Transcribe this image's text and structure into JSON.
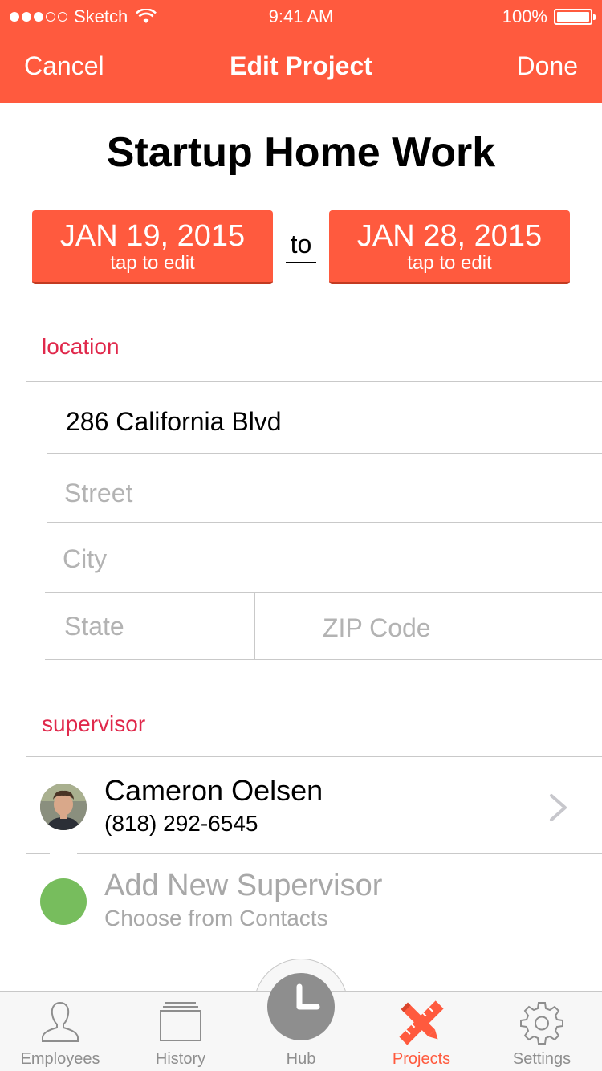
{
  "status_bar": {
    "carrier": "Sketch",
    "time": "9:41 AM",
    "battery": "100%",
    "signal_bars_filled": 3,
    "signal_bars_total": 5
  },
  "nav": {
    "cancel_label": "Cancel",
    "title": "Edit Project",
    "done_label": "Done"
  },
  "project": {
    "name": "Startup Home Work",
    "start_date": "JAN 19, 2015",
    "end_date": "JAN 28, 2015",
    "date_hint": "tap to edit",
    "date_separator": "to"
  },
  "location": {
    "section_label": "location",
    "address_value": "286 California Blvd",
    "street_placeholder": "Street",
    "city_placeholder": "City",
    "state_placeholder": "State",
    "zip_placeholder": "ZIP Code"
  },
  "supervisor": {
    "section_label": "supervisor",
    "name": "Cameron Oelsen",
    "phone": "(818) 292-6545",
    "add_title": "Add New Supervisor",
    "add_subtitle": "Choose from Contacts"
  },
  "tabbar": {
    "tabs": [
      {
        "label": "Employees",
        "icon": "person-icon"
      },
      {
        "label": "History",
        "icon": "history-stack-icon"
      },
      {
        "label": "Hub",
        "icon": "clock-icon"
      },
      {
        "label": "Projects",
        "icon": "pencil-ruler-icon"
      },
      {
        "label": "Settings",
        "icon": "gear-icon"
      }
    ],
    "active": "Projects"
  },
  "colors": {
    "brand": "#ff5a3e",
    "section_label": "#e0284b",
    "add_circle": "#77bd5d",
    "tab_inactive": "#8e8e8e"
  }
}
